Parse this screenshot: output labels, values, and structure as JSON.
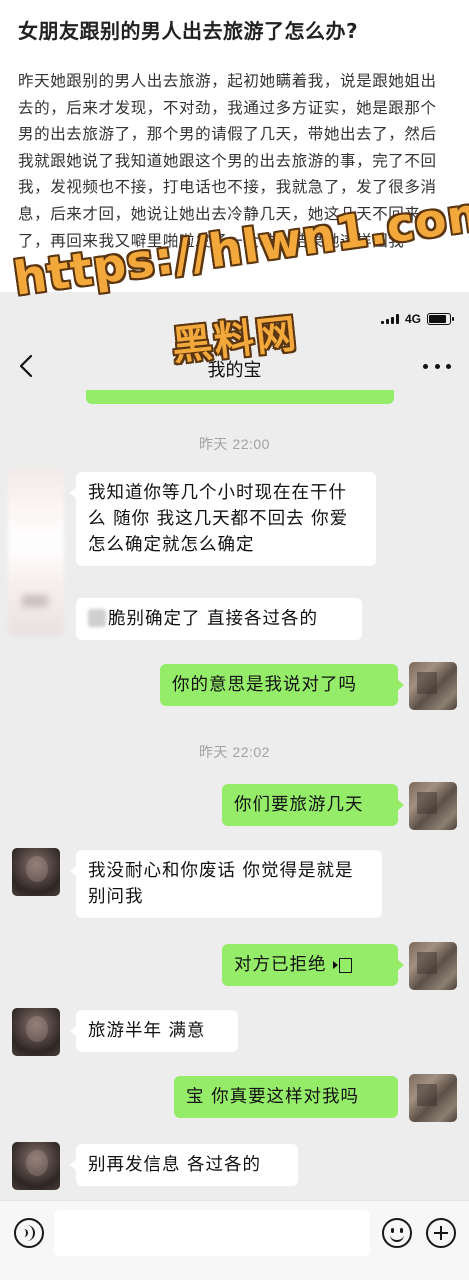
{
  "article": {
    "title": "女朋友跟别的男人出去旅游了怎么办?",
    "body": "昨天她跟别的男人出去旅游，起初她瞒着我，说是跟她姐出去的，后来才发现，不对劲，我通过多方证实，她是跟那个男的出去旅游了，那个男的请假了几天，带她出去了，然后我就跟她说了我知道她跟这个男的出去旅游的事，完了不回我，发视频也不接，打电话也不接，我就急了，发了很多消息，后来才回，她说让她出去冷静几天，她这几天不回来了，再回来我又噼里啪啦发了一大堆，结果她这样回我"
  },
  "watermark": {
    "url": "https://hlwn1.com",
    "name": "黑料网"
  },
  "status_bar": {
    "network": "4G",
    "battery_level": 0.85
  },
  "chat": {
    "title": "我的宝",
    "timestamps": [
      "昨天 22:00",
      "昨天 22:02"
    ],
    "messages": [
      {
        "side": "left",
        "text": "我知道你等几个小时现在在干什么 随你 我这几天都不回去 你爱怎么确定就怎么确定"
      },
      {
        "side": "left",
        "text": "脆别确定了 直接各过各的"
      },
      {
        "side": "right",
        "text": "你的意思是我说对了吗"
      },
      {
        "side": "right",
        "text": "你们要旅游几天"
      },
      {
        "side": "left",
        "text": "我没耐心和你废话 你觉得是就是 别问我"
      },
      {
        "side": "right",
        "text": "对方已拒绝"
      },
      {
        "side": "left",
        "text": "旅游半年 满意"
      },
      {
        "side": "right",
        "text": "宝 你真要这样对我吗"
      },
      {
        "side": "left",
        "text": "别再发信息 各过各的"
      }
    ]
  },
  "icons": {
    "back": "chevron-left-icon",
    "more": "more-dots-icon",
    "voice": "voice-input-icon",
    "emoji": "emoji-icon",
    "plus": "plus-icon"
  }
}
